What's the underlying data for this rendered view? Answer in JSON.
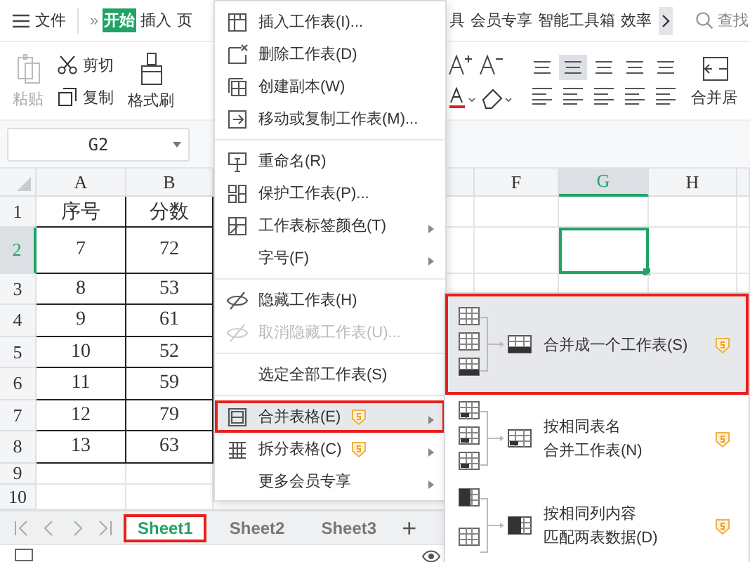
{
  "menu_bar": {
    "file": "文件",
    "more": "»",
    "tabs": [
      {
        "label": "开始",
        "selected": true
      },
      {
        "label": "插入",
        "selected": false
      },
      {
        "label": "页",
        "selected": false
      }
    ],
    "right_tabs": [
      "具",
      "会员专享",
      "智能工具箱",
      "效率"
    ],
    "search": "查找"
  },
  "toolbar": {
    "paste": {
      "label": "粘贴",
      "disabled": true
    },
    "cut": "剪切",
    "copy": "复制",
    "format_painter": "格式刷",
    "merge": "合并居"
  },
  "name_box": "G2",
  "sheet": {
    "columns": [
      {
        "label": "A",
        "selected": false
      },
      {
        "label": "B",
        "selected": false
      },
      {
        "label": "F",
        "selected": false
      },
      {
        "label": "G",
        "selected": true
      },
      {
        "label": "H",
        "selected": false
      }
    ],
    "rows": [
      {
        "label": "1",
        "selected": false,
        "cells": [
          "序号",
          "分数"
        ]
      },
      {
        "label": "2",
        "selected": true,
        "cells": [
          "7",
          "72"
        ]
      },
      {
        "label": "3",
        "selected": false,
        "cells": [
          "8",
          "53"
        ]
      },
      {
        "label": "4",
        "selected": false,
        "cells": [
          "9",
          "61"
        ]
      },
      {
        "label": "5",
        "selected": false,
        "cells": [
          "10",
          "52"
        ]
      },
      {
        "label": "6",
        "selected": false,
        "cells": [
          "11",
          "59"
        ]
      },
      {
        "label": "7",
        "selected": false,
        "cells": [
          "12",
          "79"
        ]
      },
      {
        "label": "8",
        "selected": false,
        "cells": [
          "13",
          "63"
        ]
      },
      {
        "label": "9",
        "selected": false,
        "cells": []
      },
      {
        "label": "10",
        "selected": false,
        "cells": []
      }
    ]
  },
  "sheet_tabs": {
    "tabs": [
      {
        "label": "Sheet1",
        "selected": true,
        "annotated": true
      },
      {
        "label": "Sheet2",
        "selected": false,
        "annotated": false
      },
      {
        "label": "Sheet3",
        "selected": false,
        "annotated": false
      }
    ],
    "add": "+"
  },
  "context_menu": {
    "items": [
      {
        "kind": "item",
        "label": "插入工作表(I)...",
        "disabled": false,
        "submenu": false,
        "vip": false,
        "hover": false,
        "annotated": false
      },
      {
        "kind": "item",
        "label": "删除工作表(D)",
        "disabled": false,
        "submenu": false,
        "vip": false,
        "hover": false,
        "annotated": false
      },
      {
        "kind": "item",
        "label": "创建副本(W)",
        "disabled": false,
        "submenu": false,
        "vip": false,
        "hover": false,
        "annotated": false
      },
      {
        "kind": "item",
        "label": "移动或复制工作表(M)...",
        "disabled": false,
        "submenu": false,
        "vip": false,
        "hover": false,
        "annotated": false
      },
      {
        "kind": "separator"
      },
      {
        "kind": "item",
        "label": "重命名(R)",
        "disabled": false,
        "submenu": false,
        "vip": false,
        "hover": false,
        "annotated": false
      },
      {
        "kind": "item",
        "label": "保护工作表(P)...",
        "disabled": false,
        "submenu": false,
        "vip": false,
        "hover": false,
        "annotated": false
      },
      {
        "kind": "item",
        "label": "工作表标签颜色(T)",
        "disabled": false,
        "submenu": true,
        "vip": false,
        "hover": false,
        "annotated": false
      },
      {
        "kind": "item",
        "label": "字号(F)",
        "disabled": false,
        "submenu": true,
        "vip": false,
        "hover": false,
        "annotated": false
      },
      {
        "kind": "separator"
      },
      {
        "kind": "item",
        "label": "隐藏工作表(H)",
        "disabled": false,
        "submenu": false,
        "vip": false,
        "hover": false,
        "annotated": false
      },
      {
        "kind": "item",
        "label": "取消隐藏工作表(U)...",
        "disabled": true,
        "submenu": false,
        "vip": false,
        "hover": false,
        "annotated": false
      },
      {
        "kind": "separator"
      },
      {
        "kind": "item",
        "label": "选定全部工作表(S)",
        "disabled": false,
        "submenu": false,
        "vip": false,
        "hover": false,
        "annotated": false
      },
      {
        "kind": "separator"
      },
      {
        "kind": "item",
        "label": "合并表格(E)",
        "disabled": false,
        "submenu": true,
        "vip": true,
        "hover": true,
        "annotated": true
      },
      {
        "kind": "item",
        "label": "拆分表格(C)",
        "disabled": false,
        "submenu": true,
        "vip": true,
        "hover": false,
        "annotated": false
      },
      {
        "kind": "item",
        "label": "更多会员专享",
        "disabled": false,
        "submenu": true,
        "vip": false,
        "hover": false,
        "annotated": false
      }
    ]
  },
  "submenu": {
    "items": [
      {
        "lines": [
          "合并成一个工作表(S)"
        ],
        "vip": true,
        "hover": true,
        "annotated": true
      },
      {
        "lines": [
          "按相同表名",
          "合并工作表(N)"
        ],
        "vip": true,
        "hover": false,
        "annotated": false
      },
      {
        "lines": [
          "按相同列内容",
          "匹配两表数据(D)"
        ],
        "vip": true,
        "hover": false,
        "annotated": false
      }
    ]
  }
}
